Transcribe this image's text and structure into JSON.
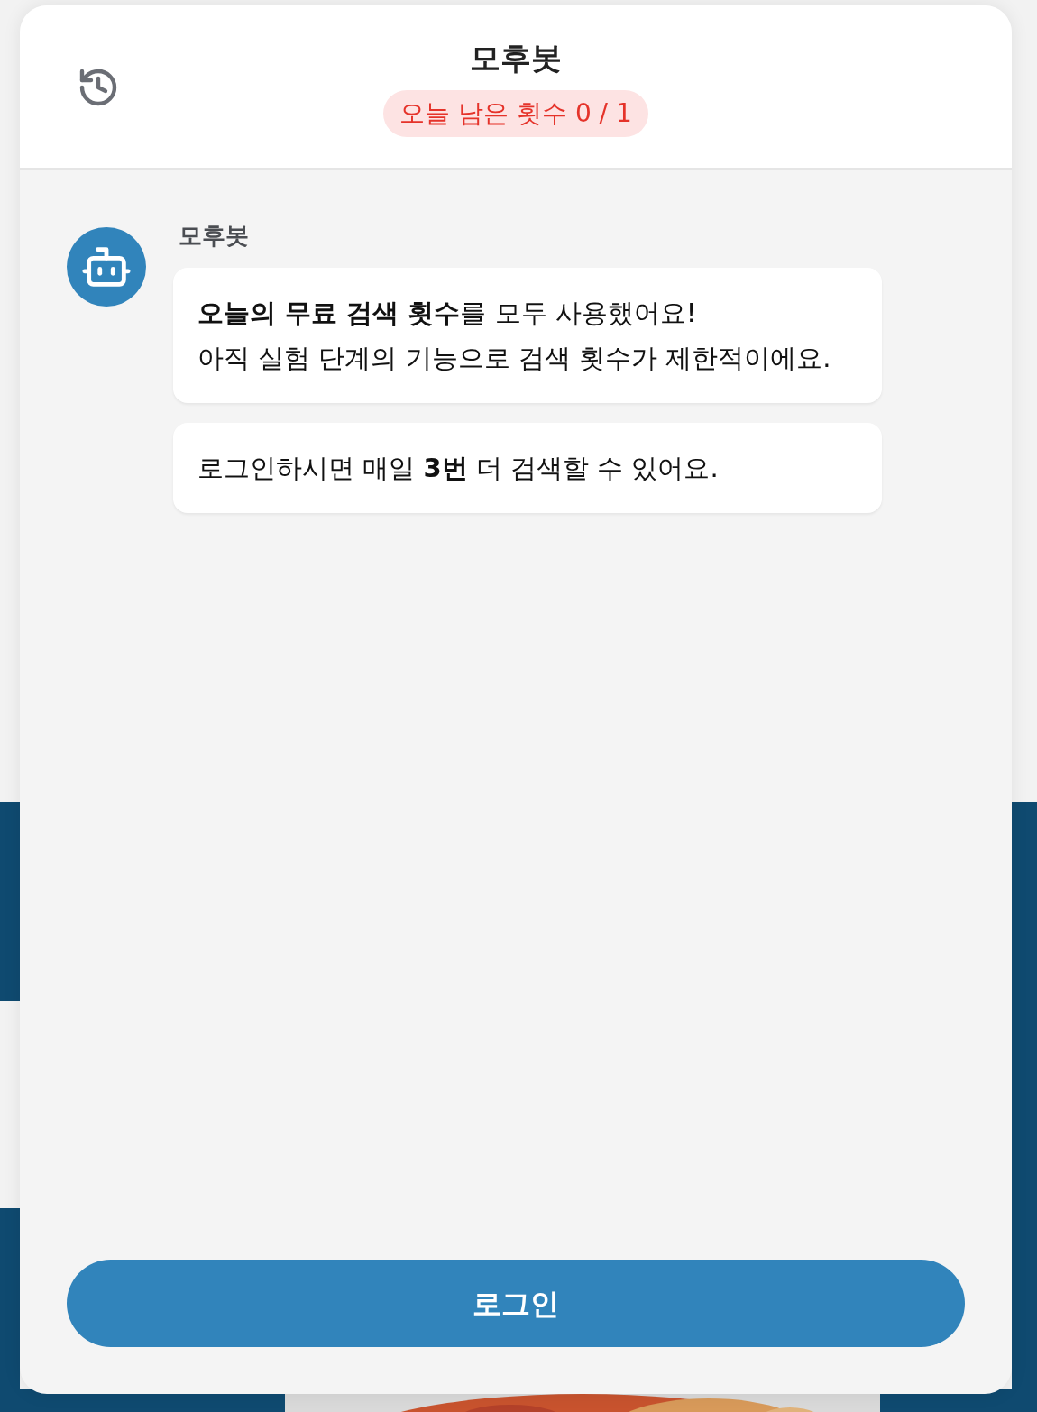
{
  "header": {
    "title": "모후봇",
    "badge": "오늘 남은 횟수 0 / 1"
  },
  "chat": {
    "sender": "모후봇",
    "messages": [
      {
        "lines": [
          "**오늘의 무료 검색 횟수**를 모두 사용했어요!",
          "아직 실험 단계의 기능으로 검색 횟수가 제한적이에요."
        ]
      },
      {
        "lines": [
          "로그인하시면 매일 **3번** 더 검색할 수 있어요."
        ]
      }
    ]
  },
  "login_button": "로그인"
}
